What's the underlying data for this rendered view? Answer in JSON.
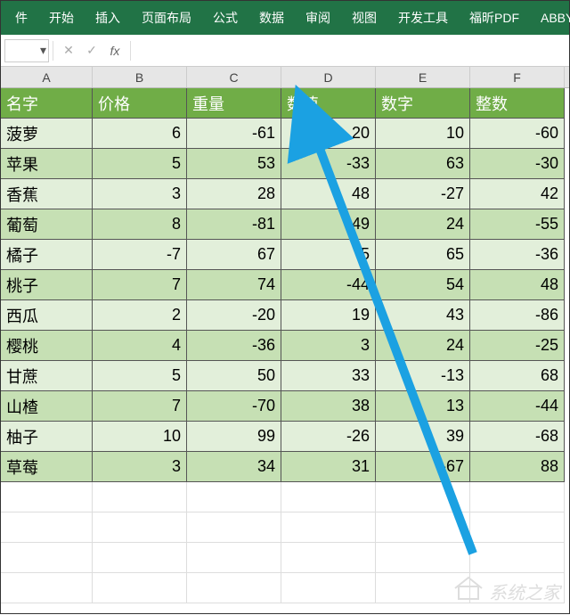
{
  "ribbon": {
    "tabs": [
      "件",
      "开始",
      "插入",
      "页面布局",
      "公式",
      "数据",
      "审阅",
      "视图",
      "开发工具",
      "福昕PDF",
      "ABBYY F"
    ]
  },
  "formulaBar": {
    "nameboxIcon": "▾",
    "cancel": "✕",
    "confirm": "✓",
    "fx": "fx"
  },
  "columns": [
    "A",
    "B",
    "C",
    "D",
    "E",
    "F"
  ],
  "headers": [
    "名字",
    "价格",
    "重量",
    "数值",
    "数字",
    "整数"
  ],
  "rows": [
    {
      "name": "菠萝",
      "vals": [
        6,
        -61,
        20,
        10,
        -60
      ]
    },
    {
      "name": "苹果",
      "vals": [
        5,
        53,
        -33,
        63,
        -30
      ]
    },
    {
      "name": "香蕉",
      "vals": [
        3,
        28,
        48,
        -27,
        42
      ]
    },
    {
      "name": "葡萄",
      "vals": [
        8,
        -81,
        49,
        24,
        -55
      ]
    },
    {
      "name": "橘子",
      "vals": [
        -7,
        67,
        5,
        65,
        -36
      ]
    },
    {
      "name": "桃子",
      "vals": [
        7,
        74,
        -44,
        54,
        48
      ]
    },
    {
      "name": "西瓜",
      "vals": [
        2,
        -20,
        19,
        43,
        -86
      ]
    },
    {
      "name": "樱桃",
      "vals": [
        4,
        -36,
        3,
        24,
        -25
      ]
    },
    {
      "name": "甘蔗",
      "vals": [
        5,
        50,
        33,
        -13,
        68
      ]
    },
    {
      "name": "山楂",
      "vals": [
        7,
        -70,
        38,
        13,
        -44
      ]
    },
    {
      "name": "柚子",
      "vals": [
        10,
        99,
        -26,
        39,
        -68
      ]
    },
    {
      "name": "草莓",
      "vals": [
        3,
        34,
        31,
        -67,
        88
      ]
    }
  ],
  "watermark": "系统之家",
  "arrow": {
    "color": "#1BA1E2"
  }
}
